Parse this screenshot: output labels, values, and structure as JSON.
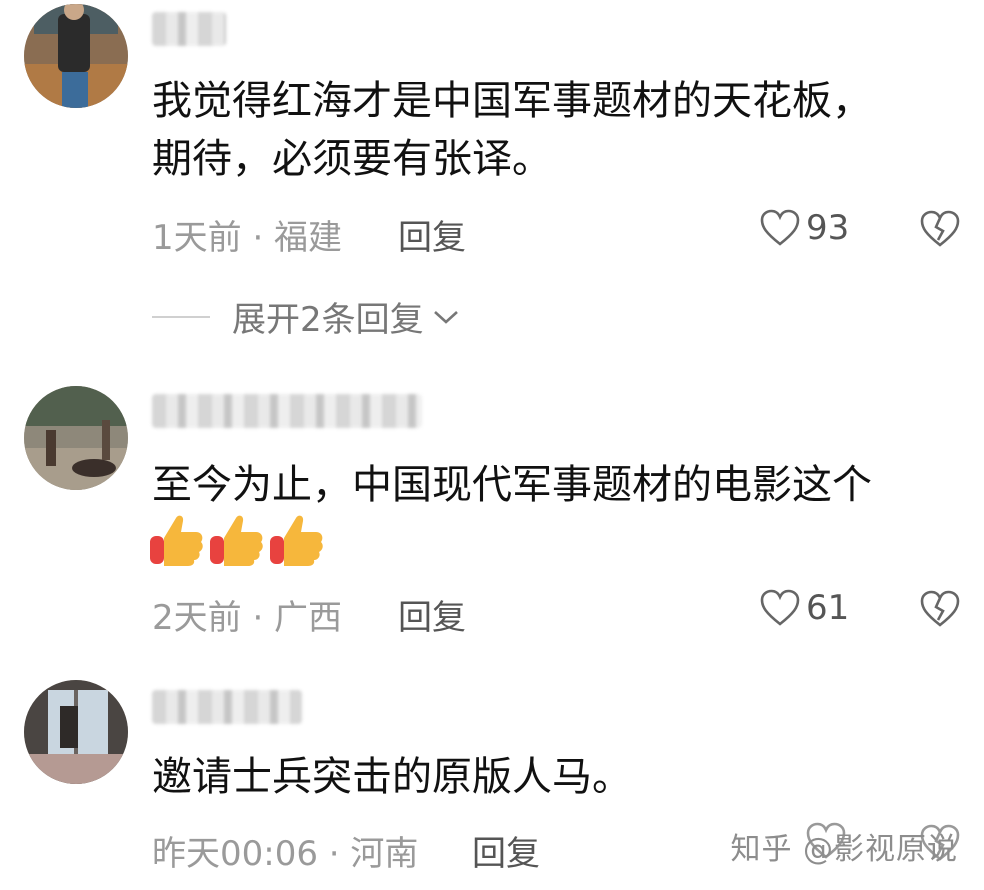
{
  "comments": [
    {
      "text_lines": [
        "我觉得红海才是中国军事题材的天花板，",
        "期待，必须要有张译。"
      ],
      "time_location": "1天前 · 福建",
      "reply_label": "回复",
      "likes": "93",
      "expand_label": "展开2条回复"
    },
    {
      "text_lines": [
        "至今为止，中国现代军事题材的电影这个"
      ],
      "emoji_icons": [
        "thumbs-up-icon",
        "thumbs-up-icon",
        "thumbs-up-icon"
      ],
      "time_location": "2天前 · 广西",
      "reply_label": "回复",
      "likes": "61"
    },
    {
      "text_lines": [
        "邀请士兵突击的原版人马。"
      ],
      "time_location": "昨天00:06 · 河南",
      "reply_label": "回复"
    }
  ],
  "watermark": "知乎 @影视原说",
  "colors": {
    "text": "#111111",
    "meta": "#9a9a9a",
    "action": "#555555",
    "emoji_yellow": "#f6b73c",
    "emoji_red": "#e8423f"
  }
}
